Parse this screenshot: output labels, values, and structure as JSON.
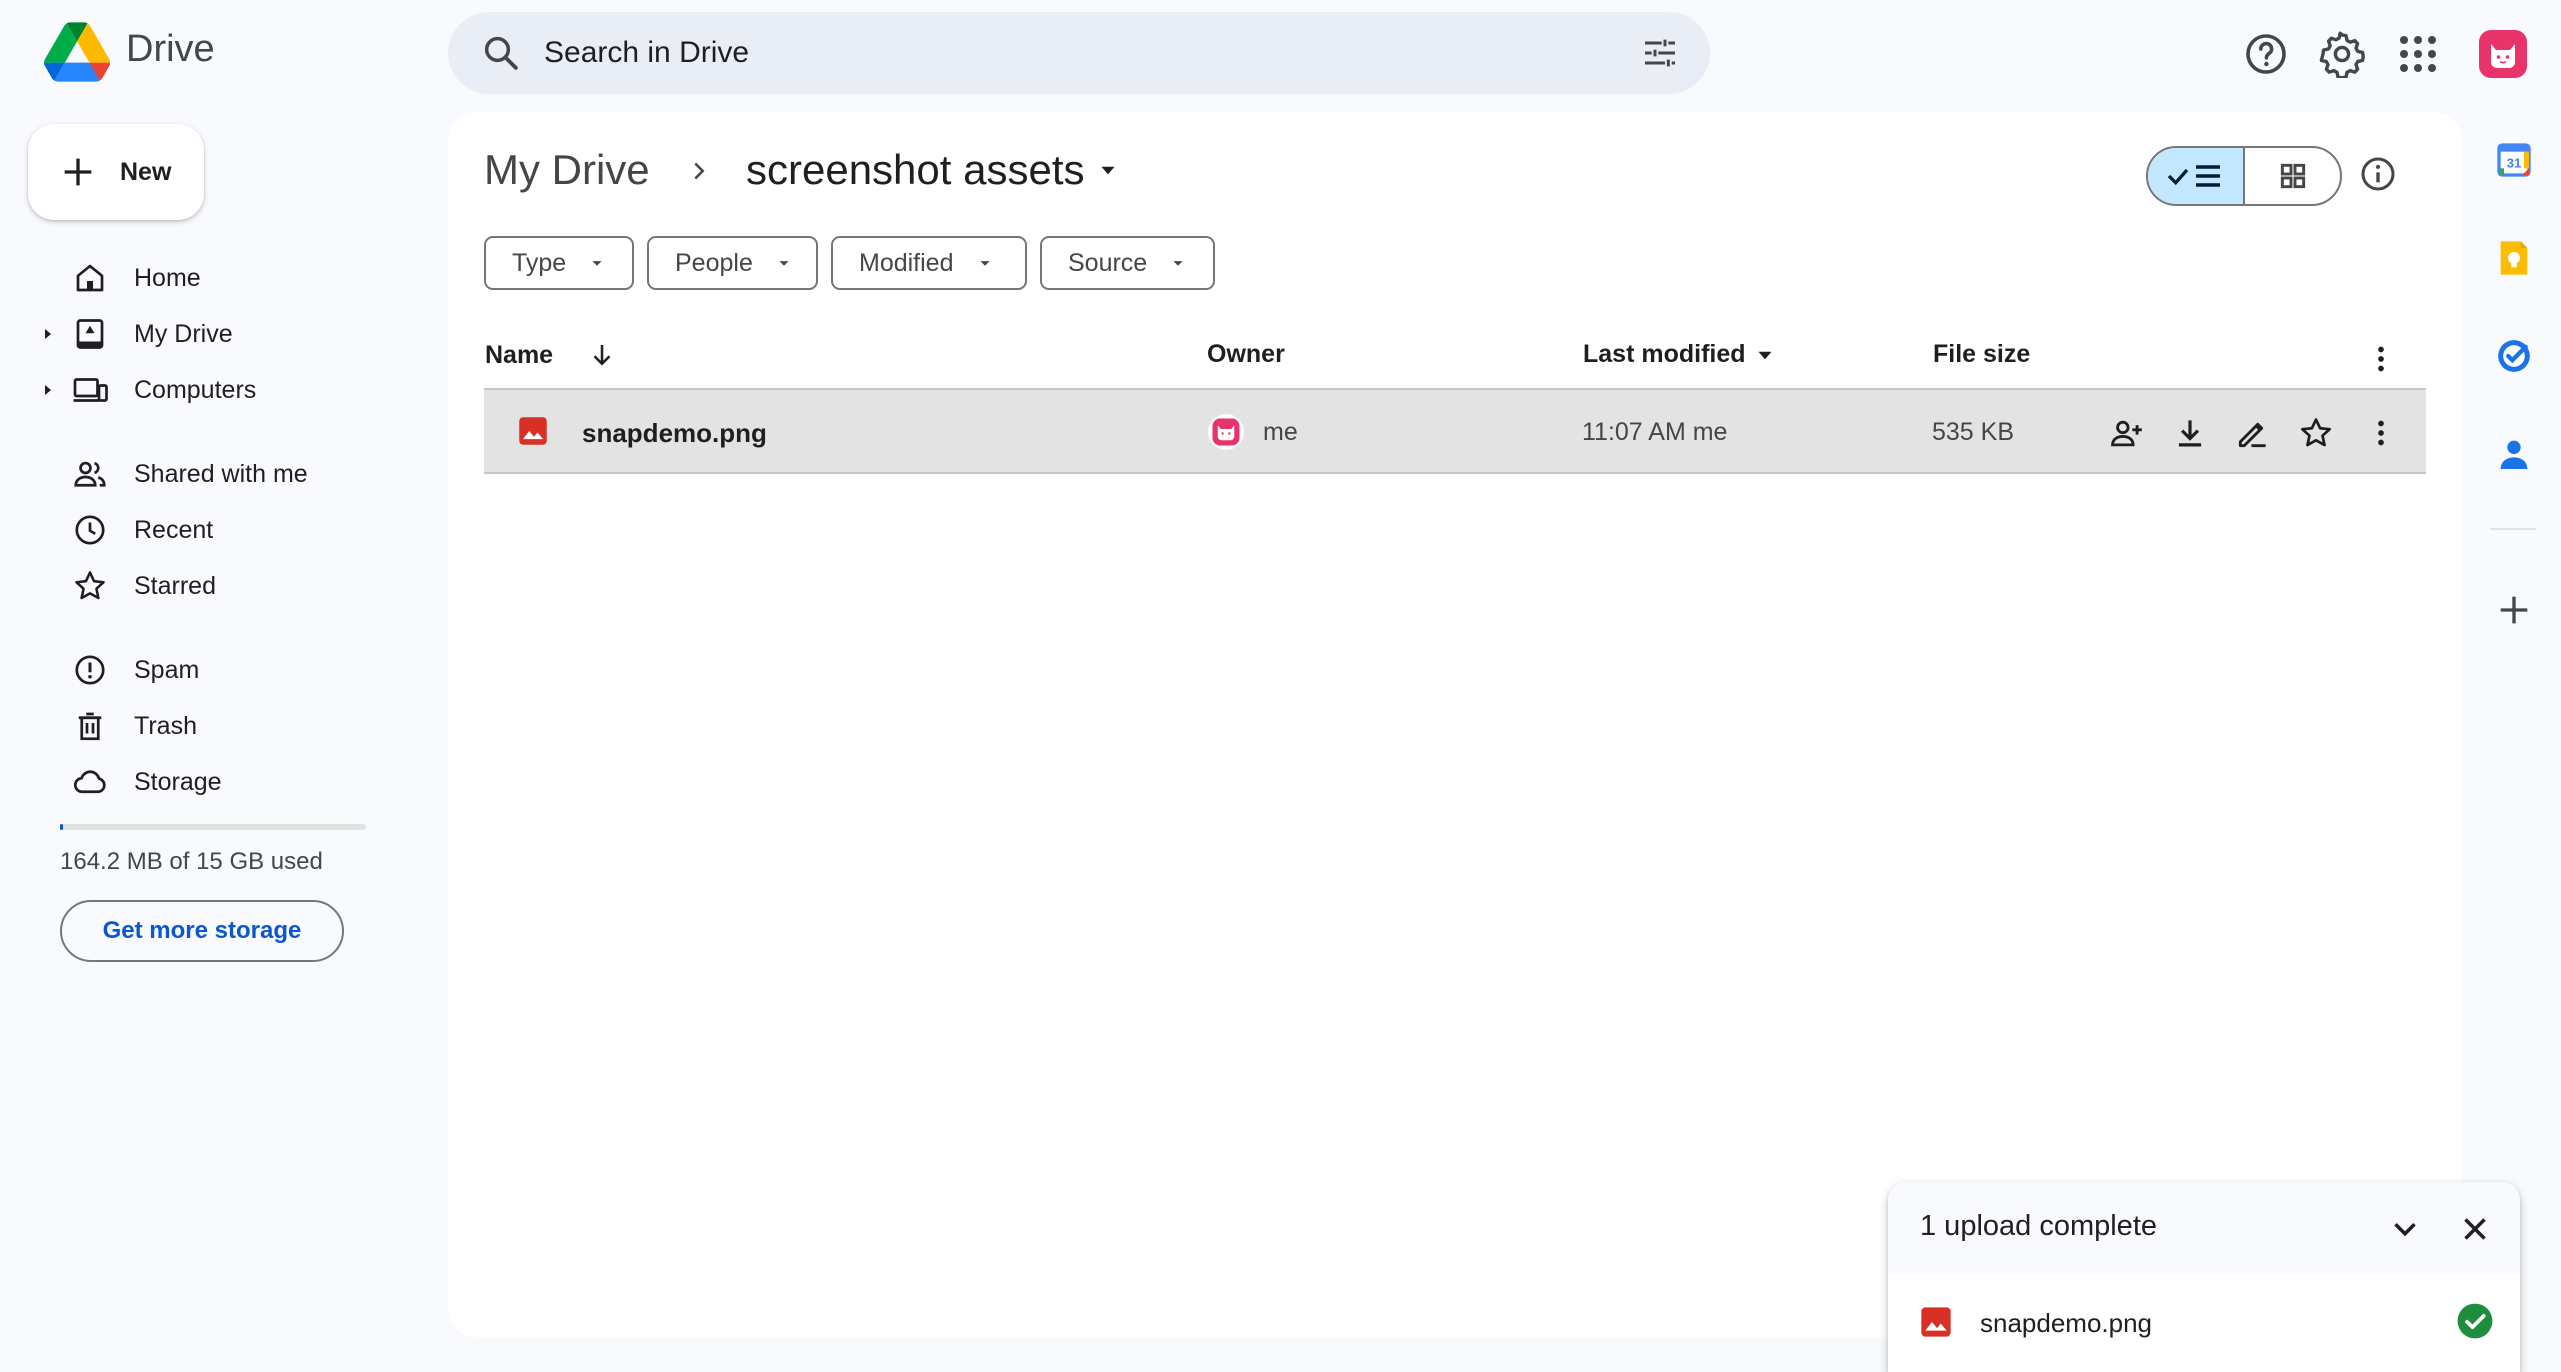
{
  "app": {
    "name": "Drive"
  },
  "search": {
    "placeholder": "Search in Drive"
  },
  "sidebar": {
    "new_label": "New",
    "items": [
      {
        "label": "Home",
        "icon": "home-icon"
      },
      {
        "label": "My Drive",
        "icon": "my-drive-icon",
        "expandable": true
      },
      {
        "label": "Computers",
        "icon": "computers-icon",
        "expandable": true
      },
      {
        "label": "Shared with me",
        "icon": "shared-icon"
      },
      {
        "label": "Recent",
        "icon": "clock-icon"
      },
      {
        "label": "Starred",
        "icon": "star-icon"
      },
      {
        "label": "Spam",
        "icon": "spam-icon"
      },
      {
        "label": "Trash",
        "icon": "trash-icon"
      },
      {
        "label": "Storage",
        "icon": "cloud-icon"
      }
    ],
    "storage": {
      "used_text": "164.2 MB of 15 GB used",
      "used_fraction": 0.011,
      "button": "Get more storage"
    }
  },
  "breadcrumb": {
    "root": "My Drive",
    "current": "screenshot assets"
  },
  "filters": [
    "Type",
    "People",
    "Modified",
    "Source"
  ],
  "table": {
    "headers": {
      "name": "Name",
      "owner": "Owner",
      "modified": "Last modified",
      "size": "File size"
    },
    "rows": [
      {
        "name": "snapdemo.png",
        "owner": "me",
        "modified": "11:07 AM me",
        "size": "535 KB"
      }
    ]
  },
  "upload": {
    "title": "1 upload complete",
    "file": "snapdemo.png"
  },
  "colors": {
    "accent": "#0b57d0",
    "selected_view": "#c2e7ff",
    "image_file": "#d93025",
    "success": "#1e8e3e"
  }
}
